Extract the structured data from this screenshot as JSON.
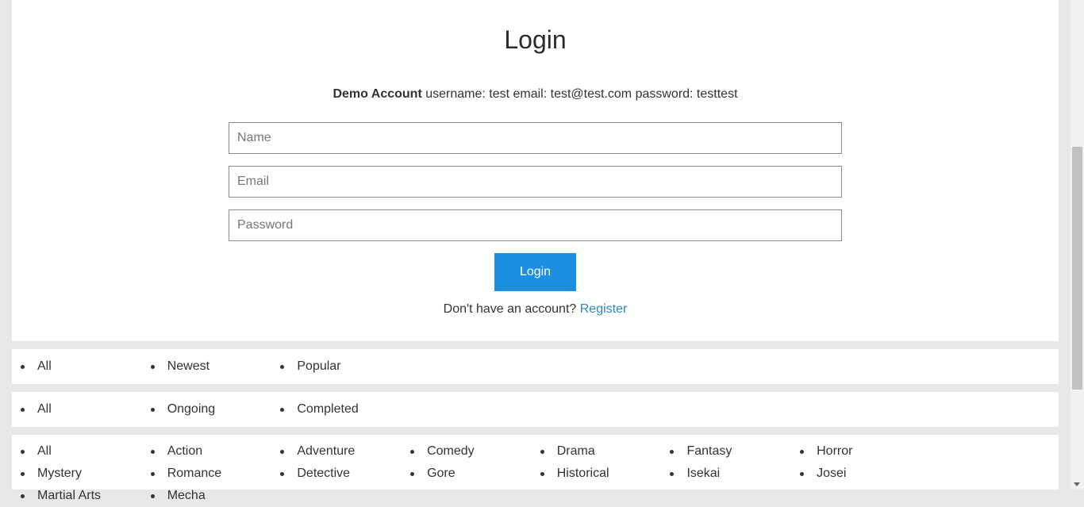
{
  "login": {
    "title": "Login",
    "demo_bold": "Demo Account",
    "demo_details": " username: test email: test@test.com password: testtest",
    "name_placeholder": "Name",
    "email_placeholder": "Email",
    "password_placeholder": "Password",
    "submit_label": "Login",
    "no_account_text": "Don't have an account? ",
    "register_link": "Register"
  },
  "filters": {
    "sort": [
      "All",
      "Newest",
      "Popular"
    ],
    "status": [
      "All",
      "Ongoing",
      "Completed"
    ],
    "genres": [
      "All",
      "Action",
      "Adventure",
      "Comedy",
      "Drama",
      "Fantasy",
      "Horror",
      "Mystery",
      "Romance",
      "Detective",
      "Gore",
      "Historical",
      "Isekai",
      "Josei",
      "Martial Arts",
      "Mecha"
    ]
  },
  "colors": {
    "accent": "#1d8fe0",
    "link": "#2b86c5",
    "background": "#e8e8e8"
  }
}
